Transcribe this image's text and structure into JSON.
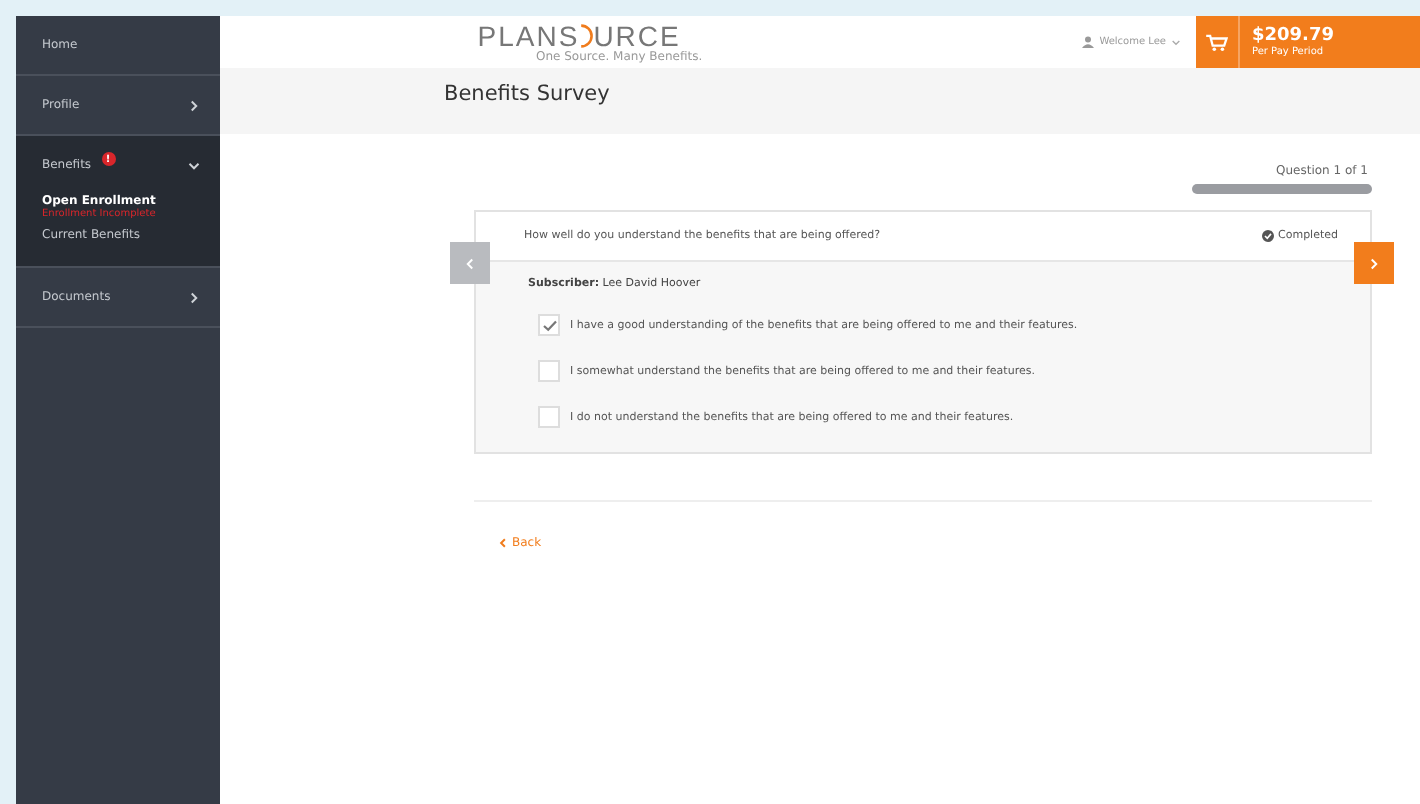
{
  "sidebar": {
    "items": [
      {
        "label": "Home",
        "kind": "link"
      },
      {
        "label": "Profile",
        "kind": "group",
        "expanded": false
      },
      {
        "label": "Benefits",
        "kind": "group",
        "expanded": true,
        "badge": "!",
        "children": [
          {
            "label": "Open Enrollment",
            "status": "Enrollment Incomplete",
            "selected": true
          },
          {
            "label": "Current Benefits",
            "selected": false
          }
        ]
      },
      {
        "label": "Documents",
        "kind": "group",
        "expanded": false
      }
    ]
  },
  "header": {
    "logo": {
      "left": "PLANS",
      "right": "URCE",
      "tagline": "One Source. Many Benefits."
    },
    "user": "Welcome Lee",
    "cart": {
      "amount": "$209.79",
      "period": "Per Pay Period"
    }
  },
  "page_title": "Benefits Survey",
  "progress": {
    "label": "Question 1 of 1",
    "level": 1
  },
  "question": {
    "text": "How well do you understand the benefits that are being offered?",
    "status": "Completed",
    "subscriber_label": "Subscriber:",
    "subscriber": "Lee David Hoover",
    "options": [
      {
        "label": "I have a good understanding of the benefits that are being offered to me and their features.",
        "checked": true
      },
      {
        "label": "I somewhat understand the benefits that are being offered to me and their features.",
        "checked": false
      },
      {
        "label": "I do not understand the benefits that are being offered to me and their features.",
        "checked": false
      }
    ]
  },
  "back": "Back"
}
